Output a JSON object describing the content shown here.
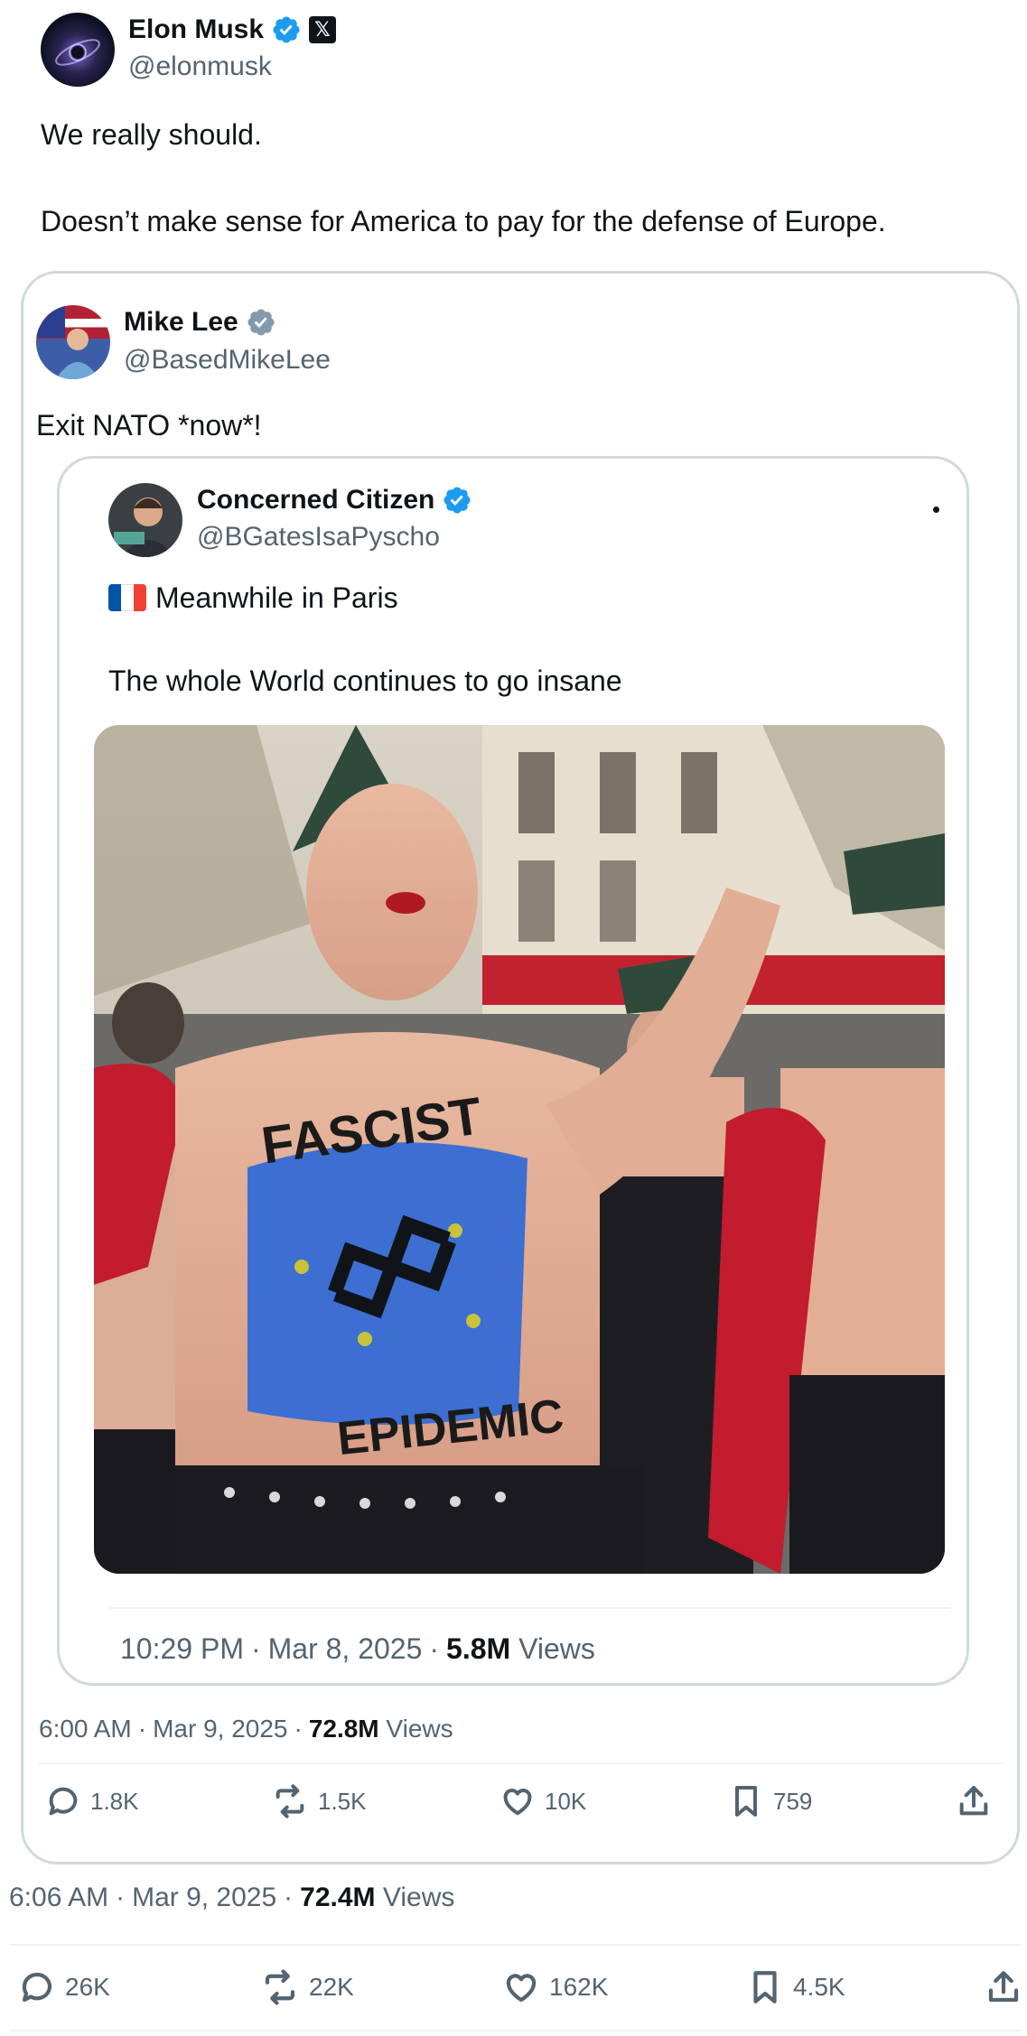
{
  "main_tweet": {
    "author_name": "Elon Musk",
    "author_handle": "@elonmusk",
    "text_line1": "We really should.",
    "text_line2": "Doesn’t make sense for America to pay for the defense of Europe.",
    "time": "6:06 AM",
    "date": "Mar 9, 2025",
    "views_count": "72.4M",
    "views_label": "Views",
    "actions": {
      "replies": "26K",
      "reposts": "22K",
      "likes": "162K",
      "bookmarks": "4.5K"
    }
  },
  "quote_tweet": {
    "author_name": "Mike Lee",
    "author_handle": "@BasedMikeLee",
    "text": "Exit NATO *now*!",
    "time": "6:00 AM",
    "date": "Mar 9, 2025",
    "views_count": "72.8M",
    "views_label": "Views",
    "actions": {
      "replies": "1.8K",
      "reposts": "1.5K",
      "likes": "10K",
      "bookmarks": "759"
    }
  },
  "nested_tweet": {
    "author_name": "Concerned Citizen",
    "author_handle": "@BGatesIsaPyscho",
    "flag": "🇫🇷",
    "text_line1": "Meanwhile in Paris",
    "text_line2": "The whole World continues to go insane",
    "image_text_1": "FASCIST",
    "image_text_2": "EPIDEMIC",
    "time": "10:29 PM",
    "date": "Mar 8, 2025",
    "views_count": "5.8M",
    "views_label": "Views"
  },
  "separator": "·",
  "colors": {
    "verified_blue": "#1d9bf0",
    "verified_gray": "#829aab",
    "muted": "#536471",
    "border": "#cfd9de"
  }
}
